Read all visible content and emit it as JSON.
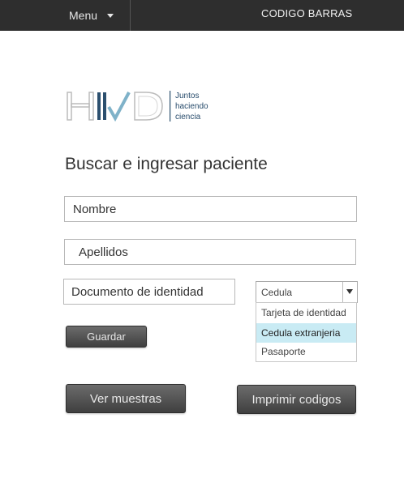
{
  "topbar": {
    "menu_label": "Menu",
    "title": "CODIGO BARRAS"
  },
  "logo": {
    "wordmark": "HVD",
    "tagline_1": "Juntos",
    "tagline_2": "haciendo",
    "tagline_3": "ciencia",
    "colors": {
      "letters": "#c8c8c8",
      "accent": "#2b4f6e",
      "check": "#7fb2c9"
    }
  },
  "page": {
    "title": "Buscar e ingresar paciente"
  },
  "form": {
    "nombre_placeholder": "Nombre",
    "apellidos_placeholder": "Apellidos",
    "documento_placeholder": "Documento de identidad",
    "doc_type": {
      "selected": "Cedula",
      "options": [
        "Tarjeta de identidad",
        "Cedula extranjeria",
        "Pasaporte"
      ],
      "highlighted_option": "Cedula extranjeria"
    },
    "guardar_label": "Guardar"
  },
  "actions": {
    "ver_label": "Ver muestras",
    "imprimir_label": "Imprimir codigos"
  },
  "colors": {
    "topbar": "#2e2e2e",
    "highlight": "#c9ebf4",
    "button_dark": "#4a4a4a"
  }
}
